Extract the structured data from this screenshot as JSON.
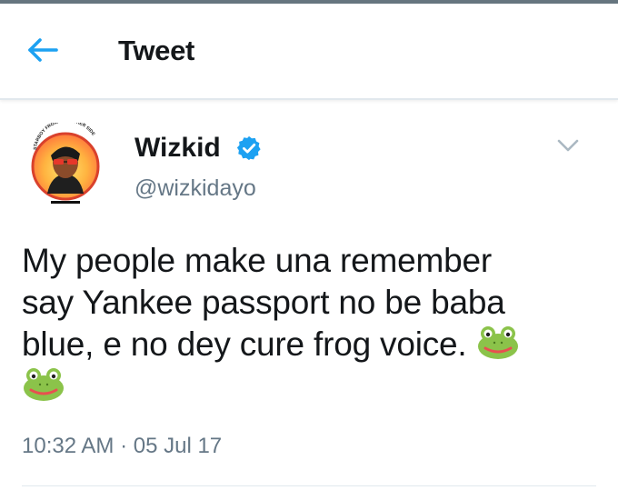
{
  "header": {
    "title": "Tweet",
    "back_icon": "arrow-left-icon",
    "accent_color": "#1da1f2"
  },
  "tweet": {
    "author_name": "Wizkid",
    "author_handle": "@wizkidayo",
    "verified": true,
    "avatar_caption": "STARBOY FROM THE OTHER SIDE",
    "text_lines": [
      "My people make una remember",
      "say Yankee passport no be baba",
      "blue, e no dey cure frog voice."
    ],
    "emoji": "frog-face",
    "timestamp": "10:32 AM · 05 Jul 17"
  },
  "colors": {
    "text": "#14171a",
    "secondary": "#657786",
    "verified_blue": "#1da1f2"
  }
}
